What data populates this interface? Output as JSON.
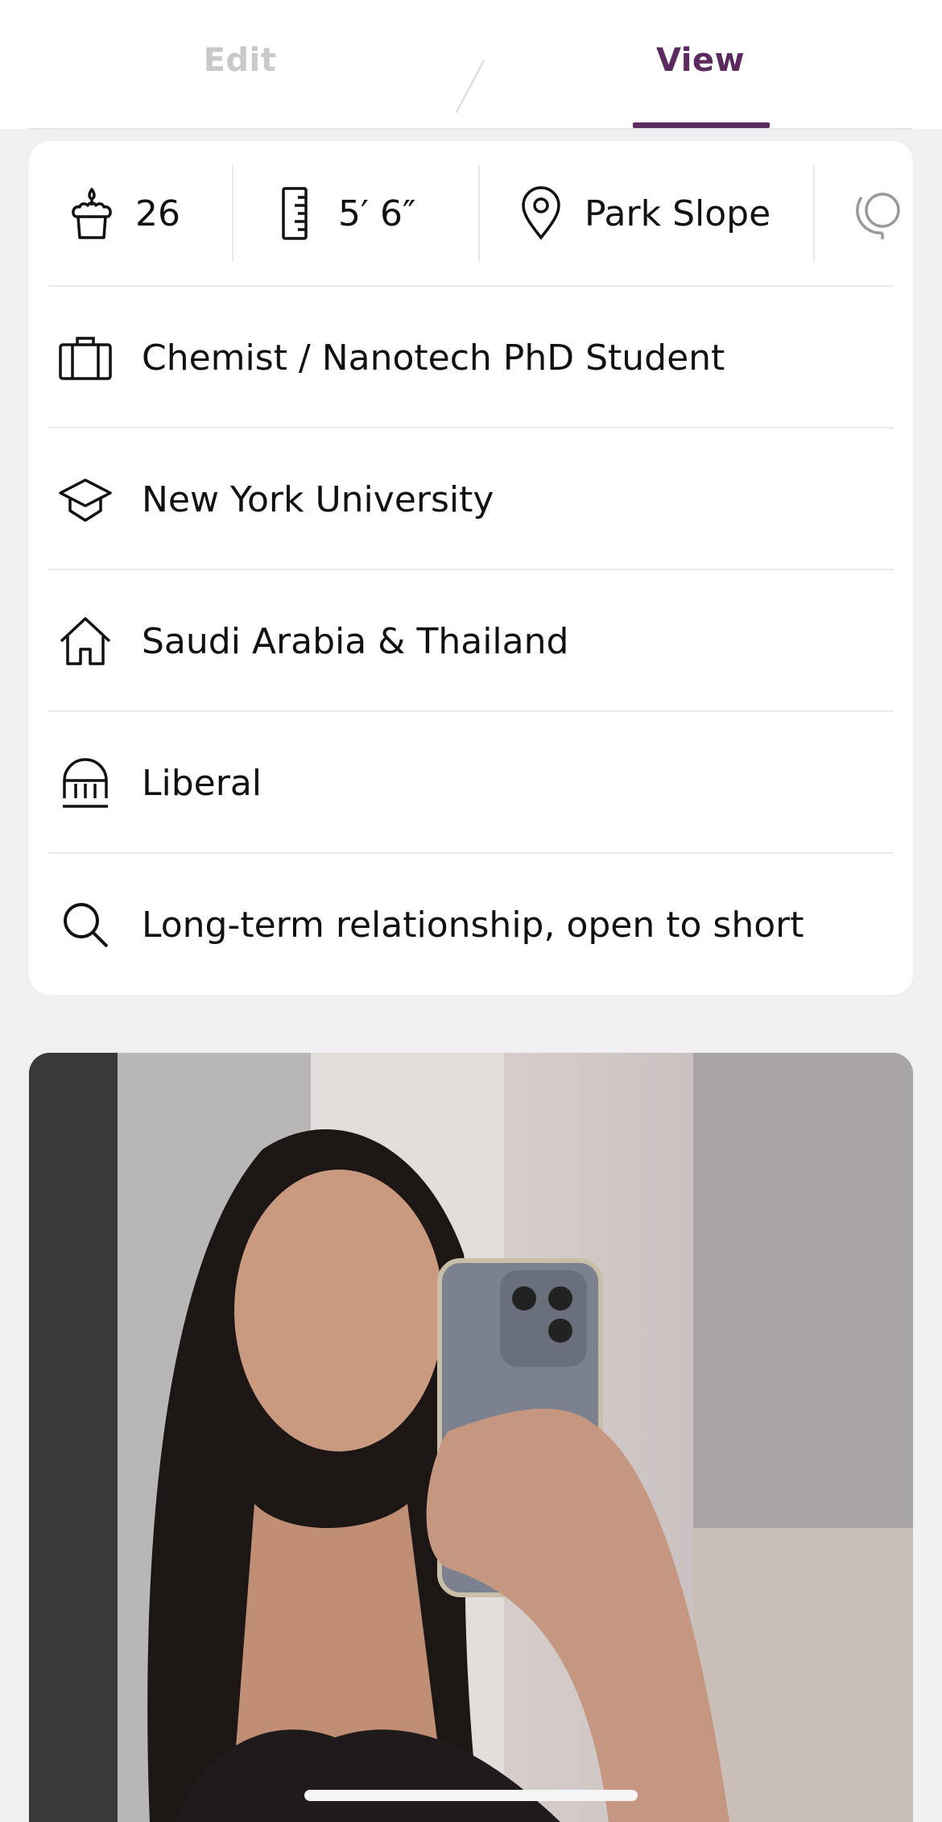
{
  "tabs": {
    "edit_label": "Edit",
    "view_label": "View",
    "active": "View"
  },
  "stats": {
    "age": "26",
    "height": "5′ 6″",
    "location": "Park Slope"
  },
  "details": [
    {
      "icon": "briefcase-icon",
      "label": "Chemist / Nanotech PhD Student"
    },
    {
      "icon": "graduation-cap-icon",
      "label": "New York University"
    },
    {
      "icon": "home-icon",
      "label": "Saudi Arabia & Thailand"
    },
    {
      "icon": "politics-dome-icon",
      "label": "Liberal"
    },
    {
      "icon": "search-icon",
      "label": "Long-term relationship, open to short"
    }
  ],
  "photo": {
    "icon": "profile-photo"
  },
  "colors": {
    "accent": "#5b2a5e",
    "inactive_tab": "#c9c9cc",
    "background": "#f0f0f2",
    "card": "#ffffff"
  }
}
